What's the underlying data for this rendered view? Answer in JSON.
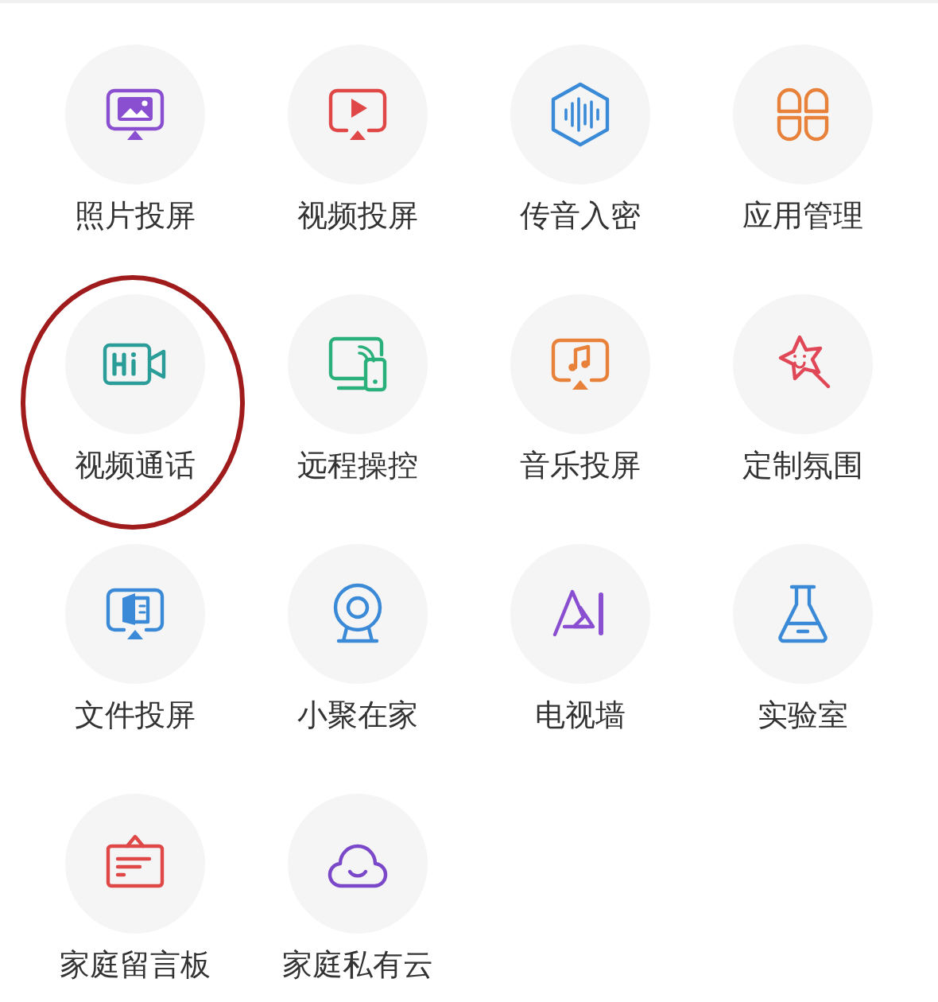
{
  "items": [
    {
      "label": "照片投屏",
      "kind": "photo",
      "color": "#8a4fd0",
      "highlighted": false
    },
    {
      "label": "视频投屏",
      "kind": "video",
      "color": "#e04848",
      "highlighted": false
    },
    {
      "label": "传音入密",
      "kind": "voice",
      "color": "#3a8ad8",
      "highlighted": false
    },
    {
      "label": "应用管理",
      "kind": "apps",
      "color": "#e8813a",
      "highlighted": false
    },
    {
      "label": "视频通话",
      "kind": "call",
      "color": "#2a9d98",
      "highlighted": true
    },
    {
      "label": "远程操控",
      "kind": "remote",
      "color": "#2ab07a",
      "highlighted": false
    },
    {
      "label": "音乐投屏",
      "kind": "music",
      "color": "#e8813a",
      "highlighted": false
    },
    {
      "label": "定制氛围",
      "kind": "star",
      "color": "#e04858",
      "highlighted": false
    },
    {
      "label": "文件投屏",
      "kind": "file",
      "color": "#3a8ad8",
      "highlighted": false
    },
    {
      "label": "小聚在家",
      "kind": "camera",
      "color": "#3a8ad8",
      "highlighted": false
    },
    {
      "label": "电视墙",
      "kind": "ai",
      "color": "#8a4fd0",
      "highlighted": false
    },
    {
      "label": "实验室",
      "kind": "lab",
      "color": "#3a8ad8",
      "highlighted": false
    },
    {
      "label": "家庭留言板",
      "kind": "board",
      "color": "#e04848",
      "highlighted": false
    },
    {
      "label": "家庭私有云",
      "kind": "cloud",
      "color": "#7a48c8",
      "highlighted": false
    }
  ]
}
